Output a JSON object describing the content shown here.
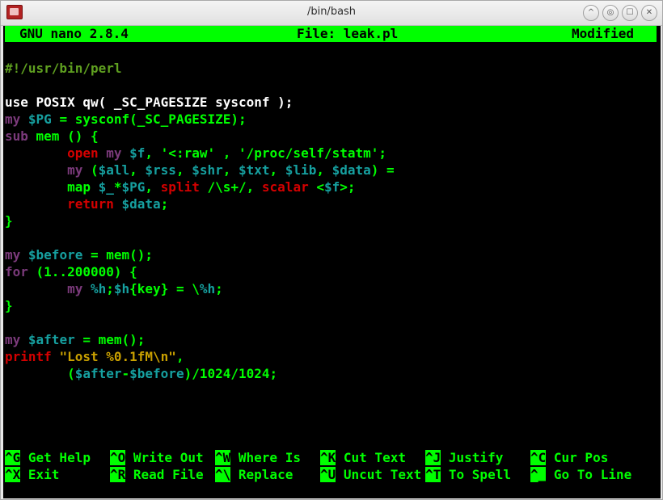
{
  "window": {
    "title": "/bin/bash",
    "controls": [
      "^",
      "◎",
      "☐",
      "✕"
    ]
  },
  "nano": {
    "version": "GNU nano 2.8.4",
    "file": "File: leak.pl",
    "status": "Modified"
  },
  "colors": {
    "green": "#00ff00",
    "comment": "#59b300",
    "keyword": "#6a2f6a",
    "var": "#1a8c8c",
    "func": "#cc0000",
    "string": "#c9a000",
    "text": "#ffffff"
  },
  "code": [
    [
      {
        "t": "#!/usr/bin/perl",
        "c": "#5fa020"
      }
    ],
    [],
    [
      {
        "t": "use POSIX qw( _SC_PAGESIZE sysconf );",
        "c": "#ffffff"
      }
    ],
    [
      {
        "t": "my ",
        "c": "#7b3a7b"
      },
      {
        "t": "$PG",
        "c": "#16a0a0"
      },
      {
        "t": " = sysconf(_SC_PAGESIZE);",
        "c": "#00ff00"
      }
    ],
    [
      {
        "t": "sub ",
        "c": "#7b3a7b"
      },
      {
        "t": "mem () {",
        "c": "#00ff00"
      }
    ],
    [
      {
        "t": "        "
      },
      {
        "t": "open ",
        "c": "#d40000"
      },
      {
        "t": "my ",
        "c": "#7b3a7b"
      },
      {
        "t": "$f",
        "c": "#16a0a0"
      },
      {
        "t": ", '<:raw' , '/proc/self/statm';",
        "c": "#00ff00"
      }
    ],
    [
      {
        "t": "        "
      },
      {
        "t": "my ",
        "c": "#7b3a7b"
      },
      {
        "t": "(",
        "c": "#00ff00"
      },
      {
        "t": "$all",
        "c": "#16a0a0"
      },
      {
        "t": ", ",
        "c": "#00ff00"
      },
      {
        "t": "$rss",
        "c": "#16a0a0"
      },
      {
        "t": ", ",
        "c": "#00ff00"
      },
      {
        "t": "$shr",
        "c": "#16a0a0"
      },
      {
        "t": ", ",
        "c": "#00ff00"
      },
      {
        "t": "$txt",
        "c": "#16a0a0"
      },
      {
        "t": ", ",
        "c": "#00ff00"
      },
      {
        "t": "$lib",
        "c": "#16a0a0"
      },
      {
        "t": ", ",
        "c": "#00ff00"
      },
      {
        "t": "$data",
        "c": "#16a0a0"
      },
      {
        "t": ") =",
        "c": "#00ff00"
      }
    ],
    [
      {
        "t": "        "
      },
      {
        "t": "map ",
        "c": "#00ff00"
      },
      {
        "t": "$_",
        "c": "#16a0a0"
      },
      {
        "t": "*",
        "c": "#00ff00"
      },
      {
        "t": "$PG",
        "c": "#16a0a0"
      },
      {
        "t": ", ",
        "c": "#00ff00"
      },
      {
        "t": "split ",
        "c": "#d40000"
      },
      {
        "t": "/\\s+/, ",
        "c": "#00ff00"
      },
      {
        "t": "scalar ",
        "c": "#d40000"
      },
      {
        "t": "<",
        "c": "#00ff00"
      },
      {
        "t": "$f",
        "c": "#16a0a0"
      },
      {
        "t": ">;",
        "c": "#00ff00"
      }
    ],
    [
      {
        "t": "        "
      },
      {
        "t": "return ",
        "c": "#d40000"
      },
      {
        "t": "$data",
        "c": "#16a0a0"
      },
      {
        "t": ";",
        "c": "#00ff00"
      }
    ],
    [
      {
        "t": "}",
        "c": "#00ff00"
      }
    ],
    [],
    [
      {
        "t": "my ",
        "c": "#7b3a7b"
      },
      {
        "t": "$before",
        "c": "#16a0a0"
      },
      {
        "t": " = mem();",
        "c": "#00ff00"
      }
    ],
    [
      {
        "t": "for ",
        "c": "#7b3a7b"
      },
      {
        "t": "(1..200000) {",
        "c": "#00ff00"
      }
    ],
    [
      {
        "t": "        "
      },
      {
        "t": "my ",
        "c": "#7b3a7b"
      },
      {
        "t": "%h",
        "c": "#16a0a0"
      },
      {
        "t": ";",
        "c": "#00ff00"
      },
      {
        "t": "$h",
        "c": "#16a0a0"
      },
      {
        "t": "{key} = \\",
        "c": "#00ff00"
      },
      {
        "t": "%h",
        "c": "#16a0a0"
      },
      {
        "t": ";",
        "c": "#00ff00"
      }
    ],
    [
      {
        "t": "}",
        "c": "#00ff00"
      }
    ],
    [],
    [
      {
        "t": "my ",
        "c": "#7b3a7b"
      },
      {
        "t": "$after",
        "c": "#16a0a0"
      },
      {
        "t": " = mem();",
        "c": "#00ff00"
      }
    ],
    [
      {
        "t": "printf ",
        "c": "#d40000"
      },
      {
        "t": "\"Lost %0.1fM\\n\"",
        "c": "#c9a000"
      },
      {
        "t": ",",
        "c": "#00ff00"
      }
    ],
    [
      {
        "t": "        (",
        "c": "#00ff00"
      },
      {
        "t": "$after",
        "c": "#16a0a0"
      },
      {
        "t": "-",
        "c": "#00ff00"
      },
      {
        "t": "$before",
        "c": "#16a0a0"
      },
      {
        "t": ")/1024/1024;",
        "c": "#00ff00"
      }
    ]
  ],
  "shortcuts": [
    [
      {
        "key": "^G",
        "label": "Get Help"
      },
      {
        "key": "^O",
        "label": "Write Out"
      },
      {
        "key": "^W",
        "label": "Where Is"
      },
      {
        "key": "^K",
        "label": "Cut Text"
      },
      {
        "key": "^J",
        "label": "Justify"
      },
      {
        "key": "^C",
        "label": "Cur Pos"
      }
    ],
    [
      {
        "key": "^X",
        "label": "Exit"
      },
      {
        "key": "^R",
        "label": "Read File"
      },
      {
        "key": "^\\",
        "label": "Replace"
      },
      {
        "key": "^U",
        "label": "Uncut Text"
      },
      {
        "key": "^T",
        "label": "To Spell"
      },
      {
        "key": "^_",
        "label": "Go To Line"
      }
    ]
  ]
}
